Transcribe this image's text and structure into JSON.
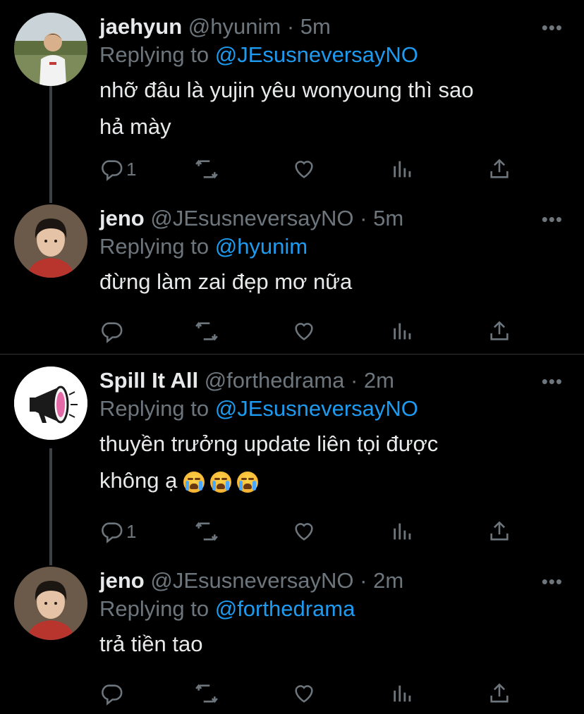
{
  "tweets": [
    {
      "name": "jaehyun",
      "handle": "@hyunim",
      "dot": "·",
      "time": "5m",
      "replying_prefix": "Replying to ",
      "replying_to": "@JEsusneversayNO",
      "text_lines": [
        "nhỡ đâu là yujin yêu wonyoung thì sao",
        "hả mày"
      ],
      "reply_count": "1",
      "more": "•••",
      "avatar_icon": "avatar-jaehyun"
    },
    {
      "name": "jeno",
      "handle": "@JEsusneversayNO",
      "dot": "·",
      "time": "5m",
      "replying_prefix": "Replying to ",
      "replying_to": "@hyunim",
      "text_lines": [
        "đừng làm zai đẹp mơ nữa"
      ],
      "reply_count": "",
      "more": "•••",
      "avatar_icon": "avatar-jeno"
    },
    {
      "name": "Spill It All",
      "handle": "@forthedrama",
      "dot": "·",
      "time": "2m",
      "replying_prefix": "Replying to ",
      "replying_to": "@JEsusneversayNO",
      "text_lines": [
        "thuyền trưởng update liên tọi được",
        "không ạ"
      ],
      "emoji": [
        "loudly-crying-face",
        "loudly-crying-face",
        "loudly-crying-face"
      ],
      "reply_count": "1",
      "more": "•••",
      "avatar_icon": "avatar-megaphone"
    },
    {
      "name": "jeno",
      "handle": "@JEsusneversayNO",
      "dot": "·",
      "time": "2m",
      "replying_prefix": "Replying to ",
      "replying_to": "@forthedrama",
      "text_lines": [
        "trả tiền tao"
      ],
      "reply_count": "",
      "more": "•••",
      "avatar_icon": "avatar-jeno"
    }
  ],
  "colors": {
    "background": "#000000",
    "text": "#e7e9ea",
    "muted": "#6e767d",
    "link": "#1d9bf0",
    "thread_line": "#3d4145"
  },
  "icons": [
    "reply-icon",
    "retweet-icon",
    "like-icon",
    "analytics-icon",
    "share-icon",
    "more-icon"
  ]
}
